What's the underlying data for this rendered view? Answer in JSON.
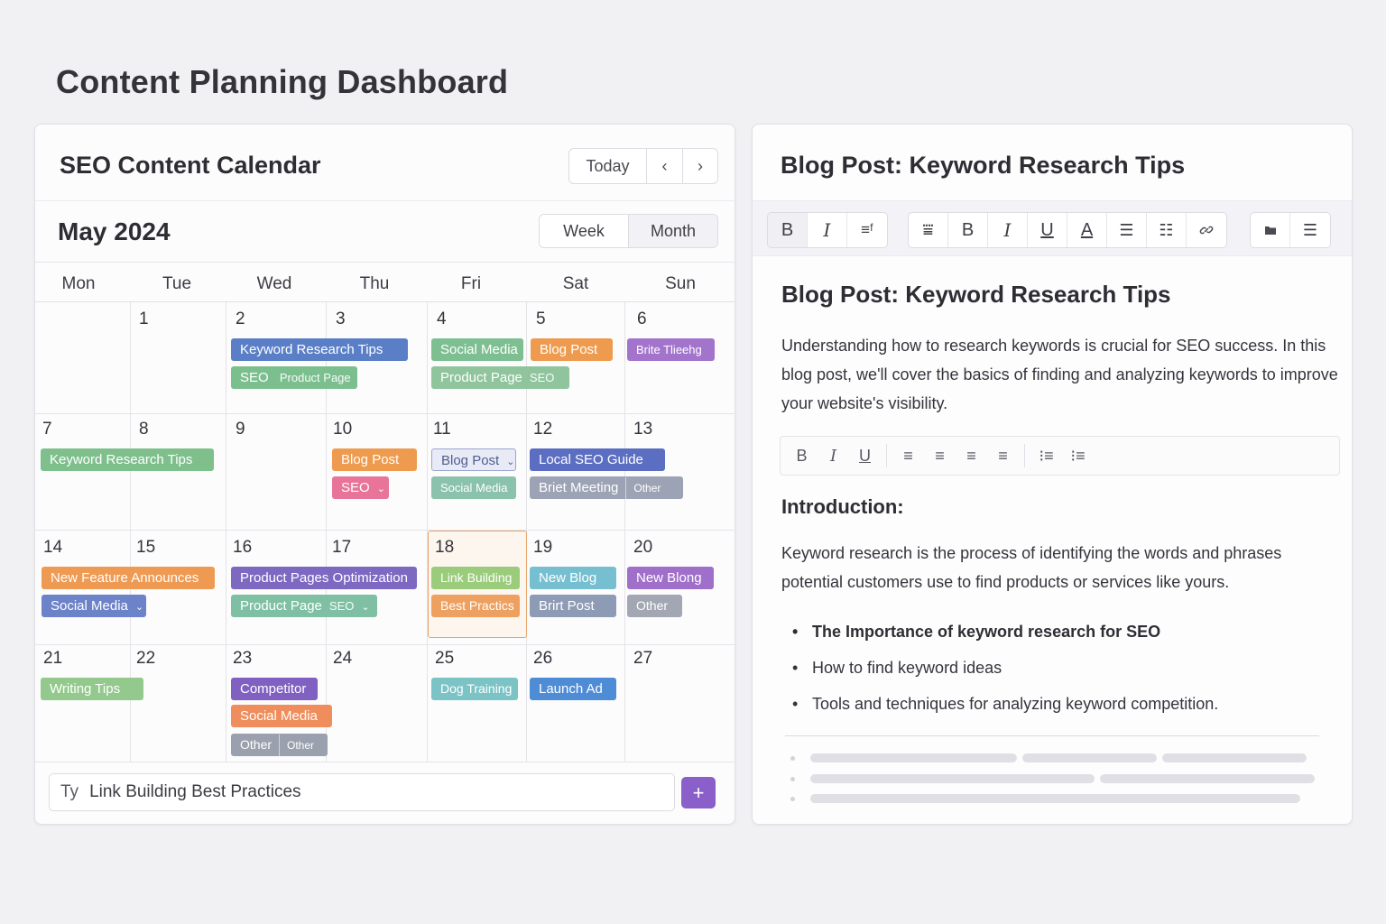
{
  "page": {
    "title": "Content Planning Dashboard"
  },
  "calendar": {
    "title": "SEO Content Calendar",
    "today_label": "Today",
    "prev_icon": "chevron-left-icon",
    "next_icon": "chevron-right-icon",
    "month_label": "May 2024",
    "views": {
      "week": "Week",
      "month": "Month",
      "selected": "Month"
    },
    "weekdays": [
      "Mon",
      "Tue",
      "Wed",
      "Thu",
      "Fri",
      "Sat",
      "Sun"
    ],
    "days": [
      "1",
      "2",
      "3",
      "4",
      "5",
      "6",
      "7",
      "8",
      "9",
      "10",
      "11",
      "12",
      "13",
      "14",
      "15",
      "16",
      "17",
      "18",
      "19",
      "20",
      "21",
      "22",
      "23",
      "24",
      "25",
      "26",
      "27"
    ],
    "highlighted_day": "18",
    "events": [
      {
        "label": "Keyword Research Tips",
        "color": "#5b7fc7"
      },
      {
        "label": "SEO",
        "label2": "Product Page",
        "color": "#7cbf8e"
      },
      {
        "label": "Social Media",
        "color": "#7dbf91"
      },
      {
        "label": "Blog Post",
        "color": "#ee9b4f"
      },
      {
        "label": "Brite Tlieehg",
        "color": "#a374cc"
      },
      {
        "label": "Product Page",
        "tag": "SEO",
        "color": "#8fc49c"
      },
      {
        "label": "Keyword Research Tips",
        "color": "#7fbf8c"
      },
      {
        "label": "Blog Post",
        "color": "#ee9b4f"
      },
      {
        "label": "SEO",
        "color": "#e8749a",
        "chevron": "⌄"
      },
      {
        "label": "Blog Post",
        "color": "#e8ebf6",
        "chevron": "⌄"
      },
      {
        "label": "Social Media",
        "color": "#8bc2ab"
      },
      {
        "label": "Local SEO Guide",
        "color": "#5b6ec2"
      },
      {
        "label": "Briet Meeting",
        "sub": "Other",
        "color": "#9ca3b4"
      },
      {
        "label": "New Feature Announces",
        "color": "#ef9a52"
      },
      {
        "label": "Social Media",
        "color": "#6c82c9",
        "chevron": "⌄"
      },
      {
        "label": "Product Pages Optimization",
        "color": "#7d68c2"
      },
      {
        "label": "Product Page",
        "tag": "SEO",
        "color": "#7fc0a4",
        "chevron": "⌄"
      },
      {
        "label": "Link Building",
        "color": "#9acc7c"
      },
      {
        "label": "Best Practics",
        "color": "#eea060"
      },
      {
        "label": "New Blog",
        "color": "#76bfd0"
      },
      {
        "label": "Brirt Post",
        "color": "#8e9bb4"
      },
      {
        "label": "New Blong",
        "color": "#a06fc9"
      },
      {
        "label": "Other",
        "color": "#a2a7b3"
      },
      {
        "label": "Writing Tips",
        "color": "#93c98c"
      },
      {
        "label": "Competitor",
        "color": "#8060c0"
      },
      {
        "label": "Social Media",
        "color": "#ef8e5c"
      },
      {
        "label": "Other",
        "sub": "Other",
        "color": "#9aa0ad"
      },
      {
        "label": "Dog Training",
        "color": "#7cc3c6"
      },
      {
        "label": "Launch Ad",
        "color": "#4f8cd6"
      }
    ],
    "quick_add": {
      "prefix": "Ty",
      "value": "Link Building Best Practices",
      "button": "+"
    }
  },
  "editor": {
    "title": "Blog Post: Keyword Research Tips",
    "toolbar": [
      {
        "icon": "bold-icon",
        "glyph": "B"
      },
      {
        "icon": "italic-icon",
        "glyph": "I"
      },
      {
        "icon": "align-icon",
        "glyph": "≡ᶠ"
      },
      {
        "icon": "indent-icon",
        "glyph": "⩸"
      },
      {
        "icon": "bold-icon",
        "glyph": "B"
      },
      {
        "icon": "italic-icon",
        "glyph": "I"
      },
      {
        "icon": "underline-icon",
        "glyph": "U"
      },
      {
        "icon": "text-color-icon",
        "glyph": "A"
      },
      {
        "icon": "numbered-list-icon",
        "glyph": "☰"
      },
      {
        "icon": "bullet-list-icon",
        "glyph": "☷"
      },
      {
        "icon": "link-icon",
        "glyph": "🔗"
      },
      {
        "icon": "folder-icon",
        "glyph": "▰"
      },
      {
        "icon": "list-icon",
        "glyph": "☰"
      }
    ],
    "heading": "Blog Post: Keyword Research Tips",
    "intro": "Understanding how to research keywords is crucial for SEO success. In this blog post, we'll cover the basics of finding and analyzing keywords to improve your website's visibility.",
    "mini_toolbar": [
      "B",
      "I",
      "U",
      "≡",
      "≡",
      "≡",
      "≡",
      "⁝≡",
      "⁝≡"
    ],
    "section_heading": "Introduction:",
    "section_body": "Keyword research is the process of identifying the words and phrases potential customers use to find products or services like yours.",
    "bullets": [
      "The Importance of keyword research for SEO",
      "How to find keyword ideas",
      "Tools and techniques for analyzing keyword competition."
    ]
  }
}
